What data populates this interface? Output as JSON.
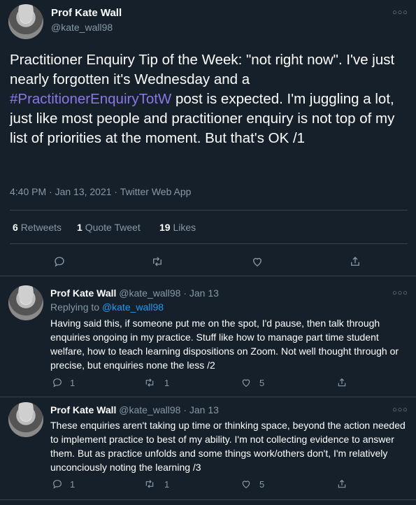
{
  "main_tweet": {
    "author_name": "Prof Kate Wall",
    "author_handle": "@kate_wall98",
    "text_before": "Practitioner Enquiry Tip of the Week: \"not right now\". I've just nearly forgotten it's Wednesday and a ",
    "hashtag": "#PractitionerEnquiryTotW",
    "text_after": " post is expected. I'm juggling a lot, just like most people and practitioner enquiry is not top of my list of priorities at the moment. But that's OK /1",
    "timestamp": "4:40 PM · Jan 13, 2021 · Twitter Web App",
    "stats": {
      "retweets_count": "6",
      "retweets_label": "Retweets",
      "quotes_count": "1",
      "quotes_label": "Quote Tweet",
      "likes_count": "19",
      "likes_label": "Likes"
    },
    "actions": [
      "reply-icon",
      "retweet-icon",
      "like-icon",
      "share-icon"
    ]
  },
  "replies": [
    {
      "author_name": "Prof Kate Wall",
      "meta": "@kate_wall98 · Jan 13",
      "replying_prefix": "Replying to ",
      "replying_handle": "@kate_wall98",
      "text": "Having said this, if someone put me on the spot, I'd pause, then talk through enquiries ongoing in my practice. Stuff like how to manage part time student welfare, how to teach learning dispositions on Zoom. Not well thought through or precise, but enquiries none the less /2",
      "reply_count": "1",
      "retweet_count": "1",
      "like_count": "5"
    },
    {
      "author_name": "Prof Kate Wall",
      "meta": "@kate_wall98 · Jan 13",
      "text": "These enquiries aren't taking up time or thinking space, beyond the action needed to implement practice to best of my ability. I'm not collecting evidence to answer them. But as practice unfolds and some things work/others don't, I'm relatively unconciously noting the learning /3",
      "reply_count": "1",
      "retweet_count": "1",
      "like_count": "5"
    }
  ],
  "colors": {
    "background": "#15202b",
    "text": "#ffffff",
    "muted": "#8899a6",
    "hashtag": "#8c76e8",
    "link": "#1d9bf0",
    "divider": "#38444d"
  }
}
